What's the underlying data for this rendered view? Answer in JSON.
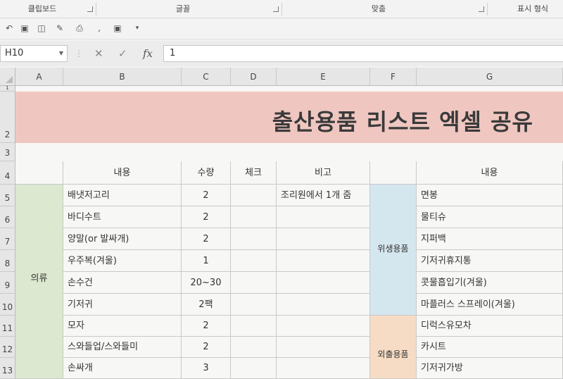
{
  "ribbon": {
    "groups": [
      "클립보드",
      "글꼴",
      "맞춤",
      "표시 형식"
    ]
  },
  "formula_bar": {
    "name_box": "H10",
    "cancel_icon": "cancel-icon",
    "enter_icon": "check-icon",
    "fx_label": "fx",
    "value": "1"
  },
  "columns": [
    "A",
    "B",
    "C",
    "D",
    "E",
    "F",
    "G"
  ],
  "rows": [
    "1",
    "2",
    "3",
    "4",
    "5",
    "6",
    "7",
    "8",
    "9",
    "10",
    "11",
    "12",
    "13"
  ],
  "sheet": {
    "title": "출산용품 리스트 엑셀 공유",
    "headers": {
      "content": "내용",
      "quantity": "수량",
      "check": "체크",
      "note": "비고",
      "content_right": "내용"
    },
    "category_left": "의류",
    "left_items": [
      {
        "name": "배냇저고리",
        "qty": "2",
        "note": "조리원에서 1개 줌"
      },
      {
        "name": "바디수트",
        "qty": "2",
        "note": ""
      },
      {
        "name": "양말(or 발싸개)",
        "qty": "2",
        "note": ""
      },
      {
        "name": "우주복(겨울)",
        "qty": "1",
        "note": ""
      },
      {
        "name": "손수건",
        "qty": "20~30",
        "note": ""
      },
      {
        "name": "기저귀",
        "qty": "2팩",
        "note": ""
      },
      {
        "name": "모자",
        "qty": "2",
        "note": ""
      },
      {
        "name": "스와들업/스와들미",
        "qty": "2",
        "note": ""
      },
      {
        "name": "손싸개",
        "qty": "3",
        "note": ""
      }
    ],
    "category_hygiene": "위생용품",
    "category_outing": "외출용품",
    "right_items": [
      "면봉",
      "물티슈",
      "지퍼백",
      "기저귀휴지통",
      "콧물흡입기(겨울)",
      "마플러스 스프레이(겨울)",
      "디럭스유모차",
      "카시트",
      "기저귀가방"
    ]
  },
  "colors": {
    "title_band": "#efc7c0",
    "clothing_category": "#dce8cf",
    "hygiene_category": "#d4e6ee",
    "outing_category": "#f6dcc5"
  }
}
